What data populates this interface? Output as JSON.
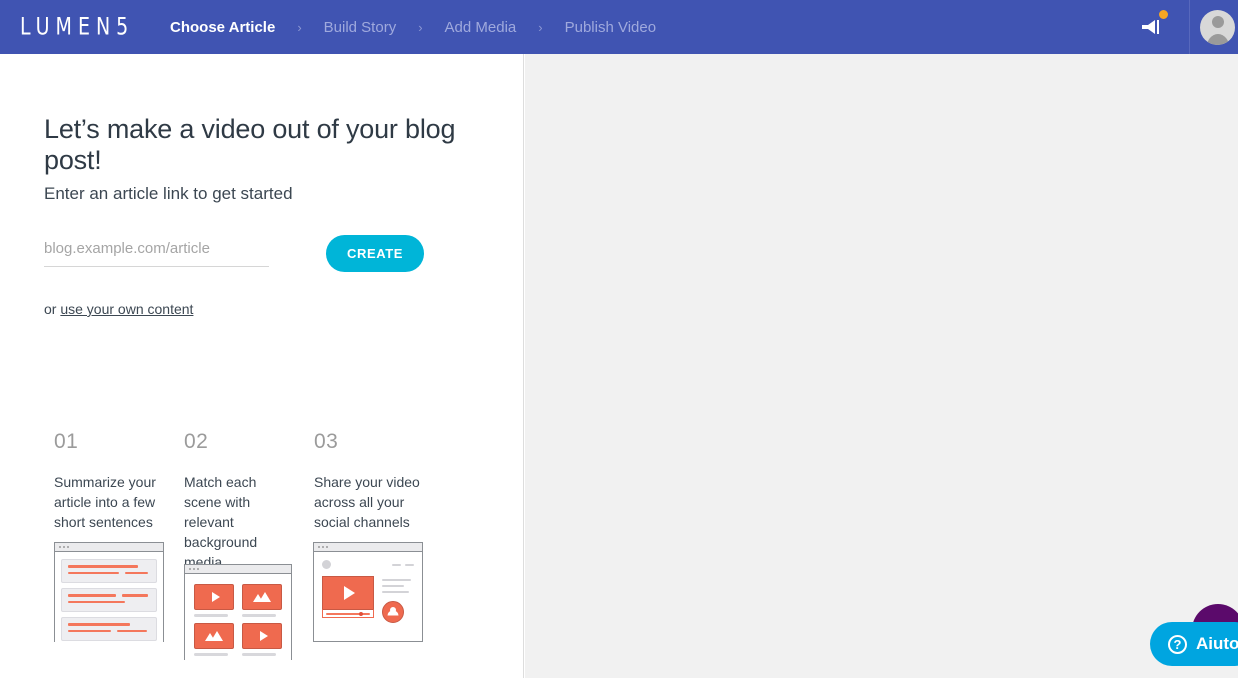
{
  "header": {
    "logo": "LUMEN5",
    "breadcrumb": [
      {
        "label": "Choose Article",
        "active": true
      },
      {
        "label": "Build Story",
        "active": false
      },
      {
        "label": "Add Media",
        "active": false
      },
      {
        "label": "Publish Video",
        "active": false
      }
    ],
    "separator": "›",
    "announcement_icon": "megaphone-icon",
    "badge_color": "#f5a623",
    "avatar_icon": "user-avatar-icon",
    "background_color": "#4054b2"
  },
  "main": {
    "title": "Let’s make a video out of your blog post!",
    "subtitle": "Enter an article link to get started",
    "url_placeholder": "blog.example.com/article",
    "url_value": "",
    "create_label": "CREATE",
    "create_color": "#00b5d8",
    "alt_prefix": "or ",
    "alt_link": "use your own content"
  },
  "steps": [
    {
      "number": "01",
      "text": "Summarize your article into a few short sentences",
      "illustration": "article-text-blocks-illustration"
    },
    {
      "number": "02",
      "text": "Match each scene with relevant background media",
      "illustration": "media-grid-illustration"
    },
    {
      "number": "03",
      "text": "Share your video across all your social channels",
      "illustration": "video-share-illustration"
    }
  ],
  "chat": {
    "label": "Aiuto",
    "icon": "question-circle-icon",
    "color": "#00a5e0",
    "blob_color": "#5b0a6b"
  }
}
